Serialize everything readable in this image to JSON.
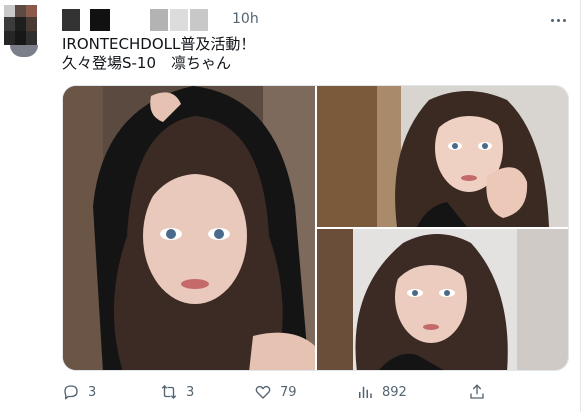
{
  "tweet": {
    "timestamp": "10h",
    "text_line1": "IRONTECHDOLL普及活動！",
    "text_line2": "久々登場S-10　凛ちゃん"
  },
  "icons": {
    "more": "more-horizontal-icon",
    "reply": "reply-bubble-icon",
    "retweet": "retweet-icon",
    "like": "heart-icon",
    "views": "bar-chart-icon",
    "share": "share-upload-icon"
  },
  "actions": {
    "reply_count": "3",
    "retweet_count": "3",
    "like_count": "79",
    "views_count": "892"
  },
  "colors": {
    "text": "#0f1419",
    "secondary": "#536471",
    "border": "#e1e6ea"
  }
}
